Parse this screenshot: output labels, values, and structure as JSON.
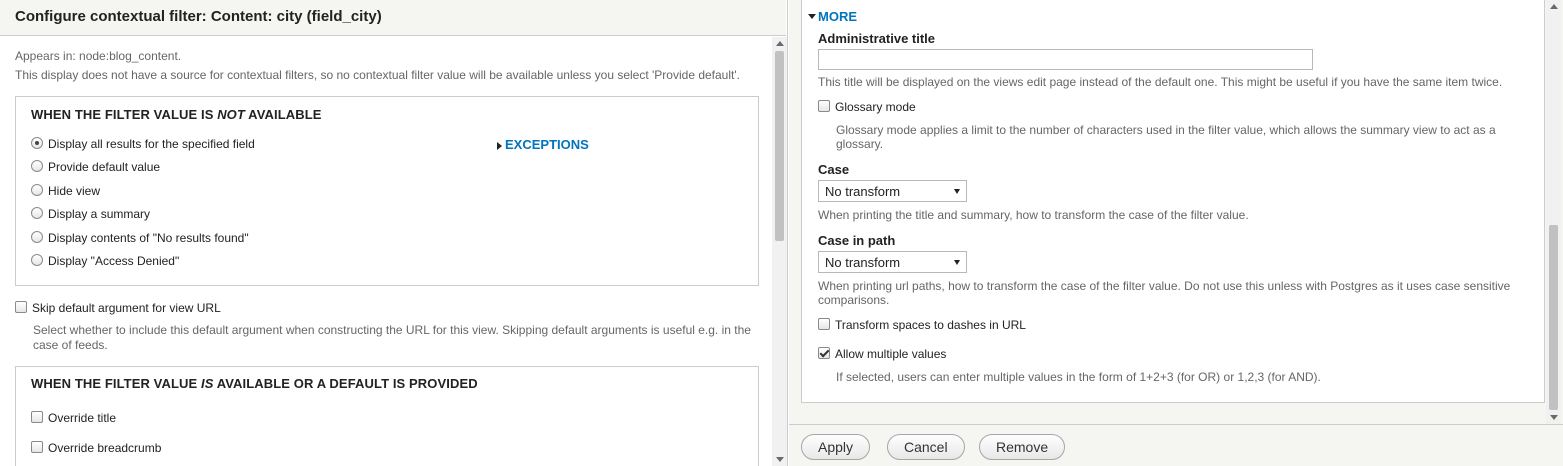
{
  "left": {
    "title": "Configure contextual filter: Content: city (field_city)",
    "appears_in": "Appears in: node:blog_content.",
    "no_source_note": "This display does not have a source for contextual filters, so no contextual filter value will be available unless you select 'Provide default'.",
    "not_available": {
      "legend_pre": "When the filter value is ",
      "legend_em": "NOT",
      "legend_post": " available",
      "options": [
        {
          "label": "Display all results for the specified field",
          "checked": true
        },
        {
          "label": "Provide default value",
          "checked": false
        },
        {
          "label": "Hide view",
          "checked": false
        },
        {
          "label": "Display a summary",
          "checked": false
        },
        {
          "label": "Display contents of \"No results found\"",
          "checked": false
        },
        {
          "label": "Display \"Access Denied\"",
          "checked": false
        }
      ],
      "exceptions_label": "EXCEPTIONS"
    },
    "skip_default": {
      "label": "Skip default argument for view URL",
      "checked": false,
      "description": "Select whether to include this default argument when constructing the URL for this view. Skipping default arguments is useful e.g. in the case of feeds."
    },
    "is_available": {
      "legend_pre": "When the filter value ",
      "legend_em": "IS",
      "legend_post": " available or a default is provided",
      "options": [
        {
          "label": "Override title",
          "checked": false
        },
        {
          "label": "Override breadcrumb",
          "checked": false
        }
      ]
    }
  },
  "right": {
    "more_label": "MORE",
    "admin_title": {
      "label": "Administrative title",
      "value": "",
      "description": "This title will be displayed on the views edit page instead of the default one. This might be useful if you have the same item twice."
    },
    "glossary": {
      "label": "Glossary mode",
      "checked": false,
      "description": "Glossary mode applies a limit to the number of characters used in the filter value, which allows the summary view to act as a glossary."
    },
    "case": {
      "label": "Case",
      "value": "No transform",
      "description": "When printing the title and summary, how to transform the case of the filter value."
    },
    "case_in_path": {
      "label": "Case in path",
      "value": "No transform",
      "description": "When printing url paths, how to transform the case of the filter value. Do not use this unless with Postgres as it uses case sensitive comparisons."
    },
    "transform_spaces": {
      "label": "Transform spaces to dashes in URL",
      "checked": false
    },
    "allow_multiple": {
      "label": "Allow multiple values",
      "checked": true,
      "description": "If selected, users can enter multiple values in the form of 1+2+3 (for OR) or 1,2,3 (for AND)."
    },
    "buttons": {
      "apply": "Apply",
      "cancel": "Cancel",
      "remove": "Remove"
    }
  }
}
